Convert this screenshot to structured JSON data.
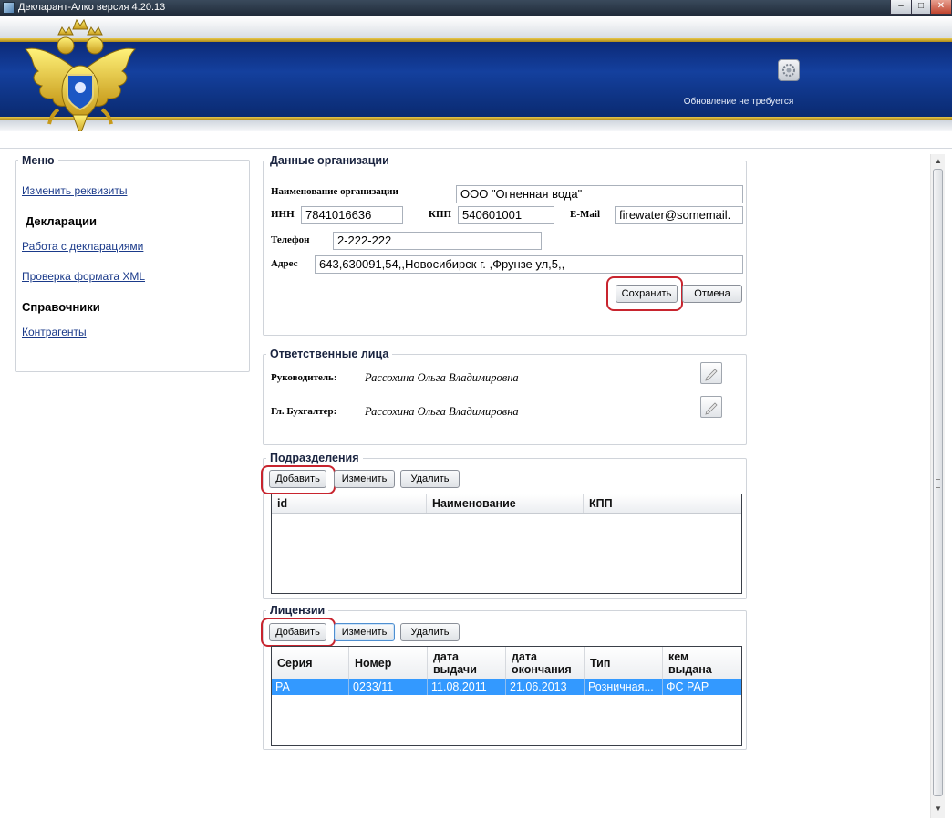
{
  "window": {
    "title": "Декларант-Алко версия 4.20.13"
  },
  "header": {
    "update_status": "Обновление не требуется",
    "icons": {
      "settings": "gear-icon",
      "emblem": "double-headed-eagle-emblem"
    }
  },
  "menu": {
    "title": "Меню",
    "edit_details": "Изменить реквизиты",
    "declarations_heading": "Декларации",
    "work_with_declarations": "Работа с декларациями",
    "xml_check": "Проверка формата XML",
    "references_heading": "Справочники",
    "counterparties": "Контрагенты"
  },
  "org": {
    "title": "Данные организации",
    "name_label": "Наименование организации",
    "name_value": "ООО \"Огненная вода\"",
    "inn_label": "ИНН",
    "inn_value": "7841016636",
    "kpp_label": "КПП",
    "kpp_value": "540601001",
    "email_label": "E-Mail",
    "email_value": "firewater@somemail.",
    "phone_label": "Телефон",
    "phone_value": "2-222-222",
    "address_label": "Адрес",
    "address_value": "643,630091,54,,Новосибирск г. ,Фрунзе ул,5,,",
    "save_label": "Сохранить",
    "cancel_label": "Отмена"
  },
  "responsible": {
    "title": "Ответственные лица",
    "head_label": "Руководитель:",
    "head_value": "Рассохина Ольга Владимировна",
    "accountant_label": "Гл. Бухгалтер:",
    "accountant_value": "Рассохина Ольга Владимировна"
  },
  "divisions": {
    "title": "Подразделения",
    "add_label": "Добавить",
    "edit_label": "Изменить",
    "delete_label": "Удалить",
    "columns": [
      "id",
      "Наименование",
      "КПП"
    ]
  },
  "licenses": {
    "title": "Лицензии",
    "add_label": "Добавить",
    "edit_label": "Изменить",
    "delete_label": "Удалить",
    "columns": [
      "Серия",
      "Номер",
      "дата\nвыдачи",
      "дата\nокончания",
      "Тип",
      "кем\nвыдана"
    ],
    "rows": [
      [
        "РА",
        "0233/11",
        "11.08.2011",
        "21.06.2013",
        "Розничная...",
        "ФС РАР"
      ]
    ]
  },
  "colors": {
    "banner_blue": "#14409e",
    "gold": "#e8c84a",
    "selection": "#3399ff",
    "highlight": "#c8242e"
  }
}
